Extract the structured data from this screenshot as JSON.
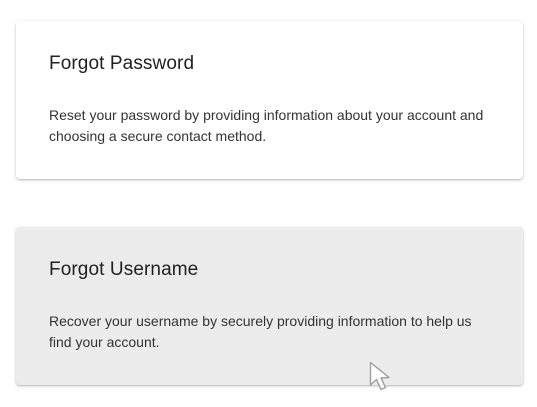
{
  "cards": [
    {
      "title": "Forgot Password",
      "description": "Reset your password by providing information about your account and choosing a secure contact method."
    },
    {
      "title": "Forgot Username",
      "description": "Recover your username by securely providing information to help us find your account."
    }
  ],
  "colors": {
    "card_default": "#ffffff",
    "card_hover": "#ececec",
    "title_text": "#212121",
    "body_text": "#333333"
  },
  "icons": {
    "pointer": "mouse-cursor-icon"
  }
}
